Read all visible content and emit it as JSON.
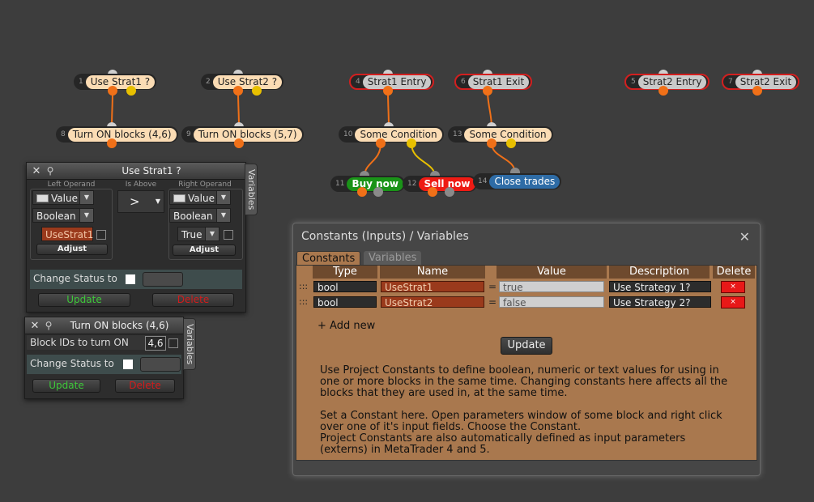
{
  "nodes": [
    {
      "num": "1",
      "label": "Use Strat1 ?"
    },
    {
      "num": "2",
      "label": "Use Strat2 ?"
    },
    {
      "num": "4",
      "label": "Strat1 Entry"
    },
    {
      "num": "6",
      "label": "Strat1 Exit"
    },
    {
      "num": "5",
      "label": "Strat2 Entry"
    },
    {
      "num": "7",
      "label": "Strat2 Exit"
    },
    {
      "num": "8",
      "label": "Turn ON blocks (4,6)"
    },
    {
      "num": "9",
      "label": "Turn ON blocks (5,7)"
    },
    {
      "num": "10",
      "label": "Some Condition"
    },
    {
      "num": "13",
      "label": "Some Condition"
    },
    {
      "num": "11",
      "label": "Buy now"
    },
    {
      "num": "12",
      "label": "Sell now"
    },
    {
      "num": "14",
      "label": "Close trades"
    }
  ],
  "panel1": {
    "title": "Use Strat1 ?",
    "variables_tab": "Variables",
    "left_operand_caption": "Left Operand",
    "is_above_caption": "Is Above",
    "right_operand_caption": "Right Operand",
    "left_type": "Value",
    "left_kind": "Boolean",
    "left_value": "UseStrat1",
    "adjust": "Adjust",
    "operator": ">",
    "right_type": "Value",
    "right_kind": "Boolean",
    "right_value": "True",
    "change_status": "Change Status to",
    "update": "Update",
    "delete": "Delete"
  },
  "panel2": {
    "title": "Turn ON blocks (4,6)",
    "variables_tab": "Variables",
    "block_ids_label": "Block IDs to turn ON",
    "block_ids_value": "4,6",
    "change_status": "Change Status to",
    "update": "Update",
    "delete": "Delete"
  },
  "constants": {
    "title": "Constants (Inputs) / Variables",
    "tabs": [
      "Constants",
      "Variables"
    ],
    "headers": {
      "type": "Type",
      "name": "Name",
      "value": "Value",
      "description": "Description",
      "delete": "Delete"
    },
    "rows": [
      {
        "drag": ":::",
        "type": "bool",
        "name": "UseStrat1",
        "eq": "=",
        "value": "true",
        "description": "Use Strategy 1?",
        "del": "×"
      },
      {
        "drag": ":::",
        "type": "bool",
        "name": "UseStrat2",
        "eq": "=",
        "value": "false",
        "description": "Use Strategy 2?",
        "del": "×"
      }
    ],
    "add_new": "+ Add new",
    "update": "Update",
    "para1": "Use Project Constants to define boolean, numeric or text values for using in one or more blocks in the same time. Changing constants here affects all the blocks that they are used in, at the same time.",
    "para2": "Set a Constant here. Open parameters window of some block and right click over one of it's input fields. Choose the Constant.",
    "para3": "Project Constants are also automatically defined as input parameters (externs) in MetaTrader 4 and 5."
  },
  "colors": {
    "canvas": "#3d3d3d",
    "wire": "#f07018",
    "wire_yellow": "#e8c000",
    "constants_body": "#a9784e",
    "highlight_ring": "#d31f1f"
  }
}
